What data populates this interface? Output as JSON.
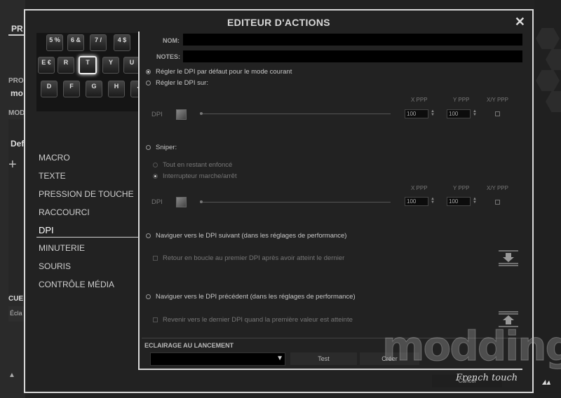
{
  "background": {
    "left_texts": [
      "PR",
      "PRO",
      "mo",
      "MOD",
      "Def",
      "+",
      "CUE",
      "Écla"
    ],
    "bottom_left_icon": "▲",
    "bottom_right_icon": "corsair-sails-icon"
  },
  "modal": {
    "title": "EDITEUR D'ACTIONS",
    "close_label": "✕"
  },
  "keyboard": {
    "row1": [
      "5 %",
      "6 &",
      "7 /",
      "4 $"
    ],
    "row2": [
      "E €",
      "R",
      "T",
      "Y",
      "U"
    ],
    "row3": [
      "D",
      "F",
      "G",
      "H",
      "J"
    ],
    "selected_key": "T"
  },
  "menu": {
    "items": [
      "MACRO",
      "TEXTE",
      "PRESSION DE TOUCHE",
      "RACCOURCI",
      "DPI",
      "MINUTERIE",
      "SOURIS",
      "CONTRÔLE MÉDIA"
    ],
    "active": "DPI"
  },
  "form": {
    "nom_label": "NOM:",
    "nom_value": "",
    "notes_label": "NOTES:",
    "notes_value": "",
    "opt_default": "Régler le DPI par défaut pour le mode courant",
    "opt_set": "Régler le DPI sur:",
    "dpi_label": "DPI",
    "xppp": "X PPP",
    "yppp": "Y PPP",
    "xyppp": "X/Y PPP",
    "x_value": "100",
    "y_value": "100",
    "sniper_label": "Sniper:",
    "sniper_hold": "Tout en restant enfoncé",
    "sniper_toggle": "Interrupteur marche/arrêt",
    "dpi_label2": "DPI",
    "xppp2": "X PPP",
    "yppp2": "Y PPP",
    "xyppp2": "X/Y PPP",
    "x_value2": "100",
    "y_value2": "100",
    "next_label": "Naviguer vers le DPI suivant (dans les réglages de performance)",
    "next_loop": "Retour en boucle au premier DPI après avoir atteint le dernier",
    "prev_label": "Naviguer vers le DPI précédent (dans les réglages de performance)",
    "prev_loop": "Revenir vers le dernier DPI quand la première valeur est atteinte",
    "lighting_label": "ECLAIRAGE AU LANCEMENT",
    "lighting_value": "",
    "test_button": "Test",
    "create_button": "Créer",
    "cancel_button": "Cancel"
  },
  "watermark": {
    "text": "modding.fr",
    "subtitle": "French touch"
  }
}
